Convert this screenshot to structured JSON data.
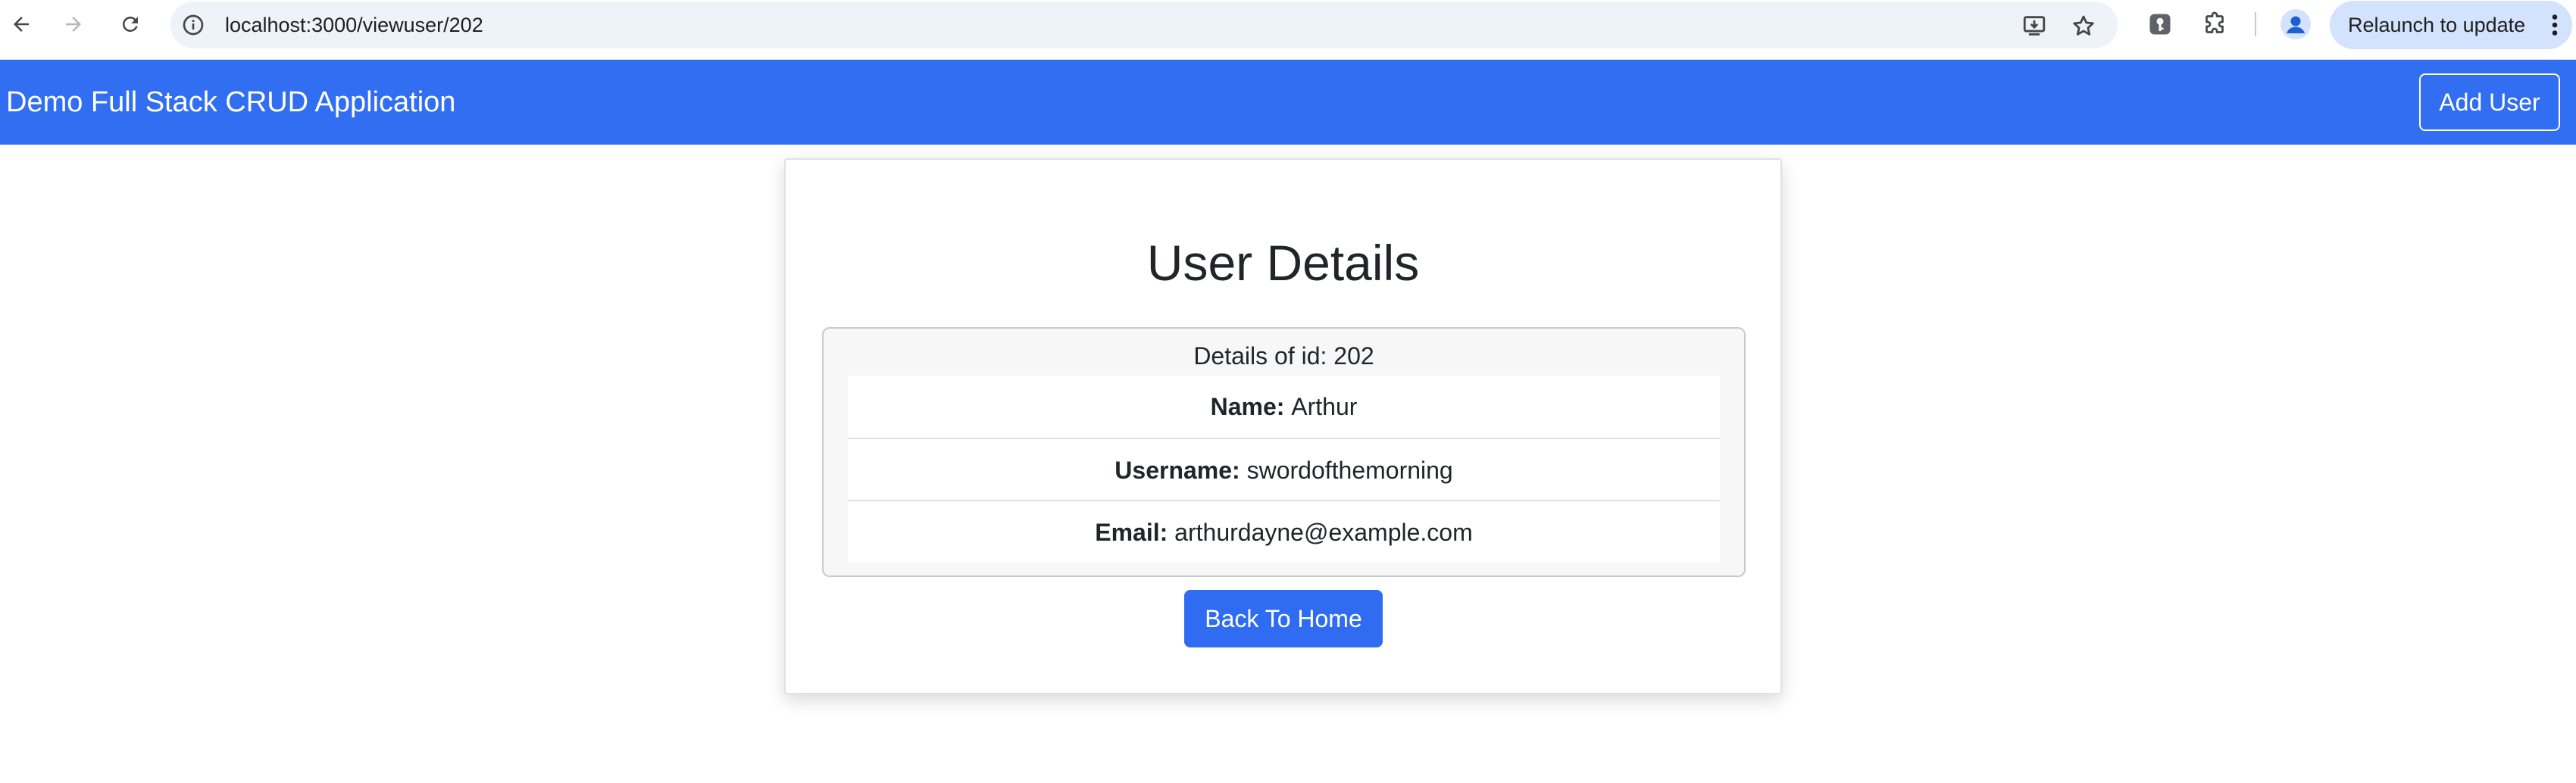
{
  "browser": {
    "url": "localhost:3000/viewuser/202",
    "relaunch_label": "Relaunch to update",
    "icons": [
      "back-icon",
      "forward-icon",
      "reload-icon",
      "site-info-icon",
      "install-icon",
      "star-icon",
      "password-manager-icon",
      "extensions-icon",
      "profile-icon",
      "more-icon"
    ]
  },
  "navbar": {
    "brand": "Demo Full Stack CRUD Application",
    "add_user_label": "Add User",
    "background_color": "#316ef2"
  },
  "card": {
    "title": "User Details",
    "details_header": "Details of id: 202",
    "fields": [
      {
        "label": "Name:",
        "value": "Arthur"
      },
      {
        "label": "Username:",
        "value": "swordofthemorning"
      },
      {
        "label": "Email:",
        "value": "arthurdayne@example.com"
      }
    ],
    "back_label": "Back To Home",
    "button_color": "#2f6cf2"
  }
}
